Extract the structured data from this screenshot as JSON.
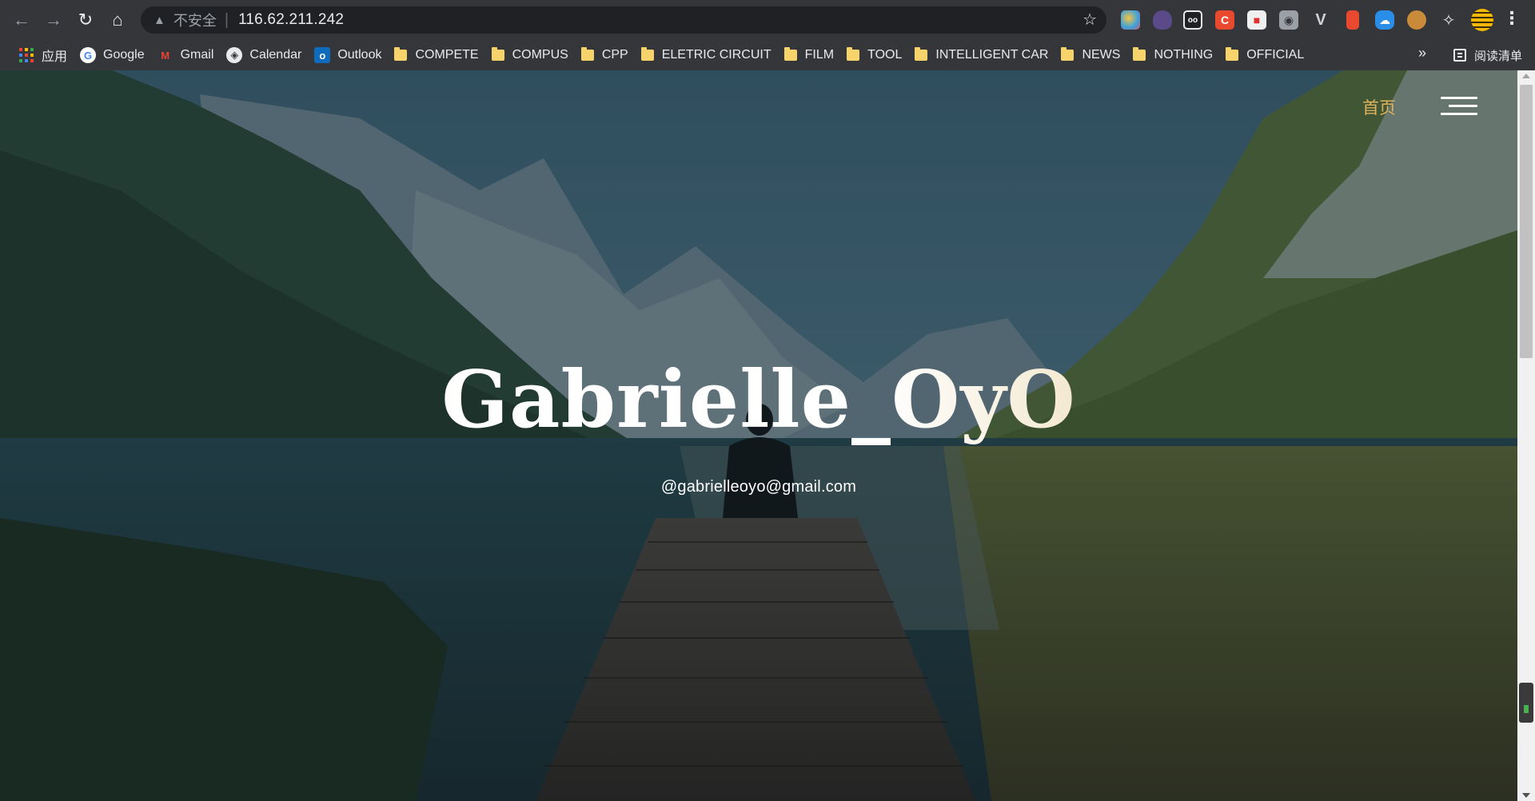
{
  "browser": {
    "security_label": "不安全",
    "url": "116.62.211.242",
    "bookmarks": [
      {
        "label": "应用",
        "icon": "apps-grid-icon"
      },
      {
        "label": "Google",
        "icon": "google-icon"
      },
      {
        "label": "Gmail",
        "icon": "gmail-icon"
      },
      {
        "label": "Calendar",
        "icon": "calendar-icon"
      },
      {
        "label": "Outlook",
        "icon": "outlook-icon"
      },
      {
        "label": "COMPETE",
        "icon": "folder-icon"
      },
      {
        "label": "COMPUS",
        "icon": "folder-icon"
      },
      {
        "label": "CPP",
        "icon": "folder-icon"
      },
      {
        "label": "ELETRIC CIRCUIT",
        "icon": "folder-icon"
      },
      {
        "label": "FILM",
        "icon": "folder-icon"
      },
      {
        "label": "TOOL",
        "icon": "folder-icon"
      },
      {
        "label": "INTELLIGENT CAR",
        "icon": "folder-icon"
      },
      {
        "label": "NEWS",
        "icon": "folder-icon"
      },
      {
        "label": "NOTHING",
        "icon": "folder-icon"
      },
      {
        "label": "OFFICIAL",
        "icon": "folder-icon"
      }
    ],
    "more_bookmarks": "»",
    "reading_list": "阅读清单"
  },
  "page": {
    "nav_home": "首页",
    "hero_title": "Gabrielle_OyO",
    "hero_email": "@gabrielleoyo@gmail.com",
    "accent_color": "#e0b25c",
    "title_gradient_start": "#e8c98b"
  }
}
